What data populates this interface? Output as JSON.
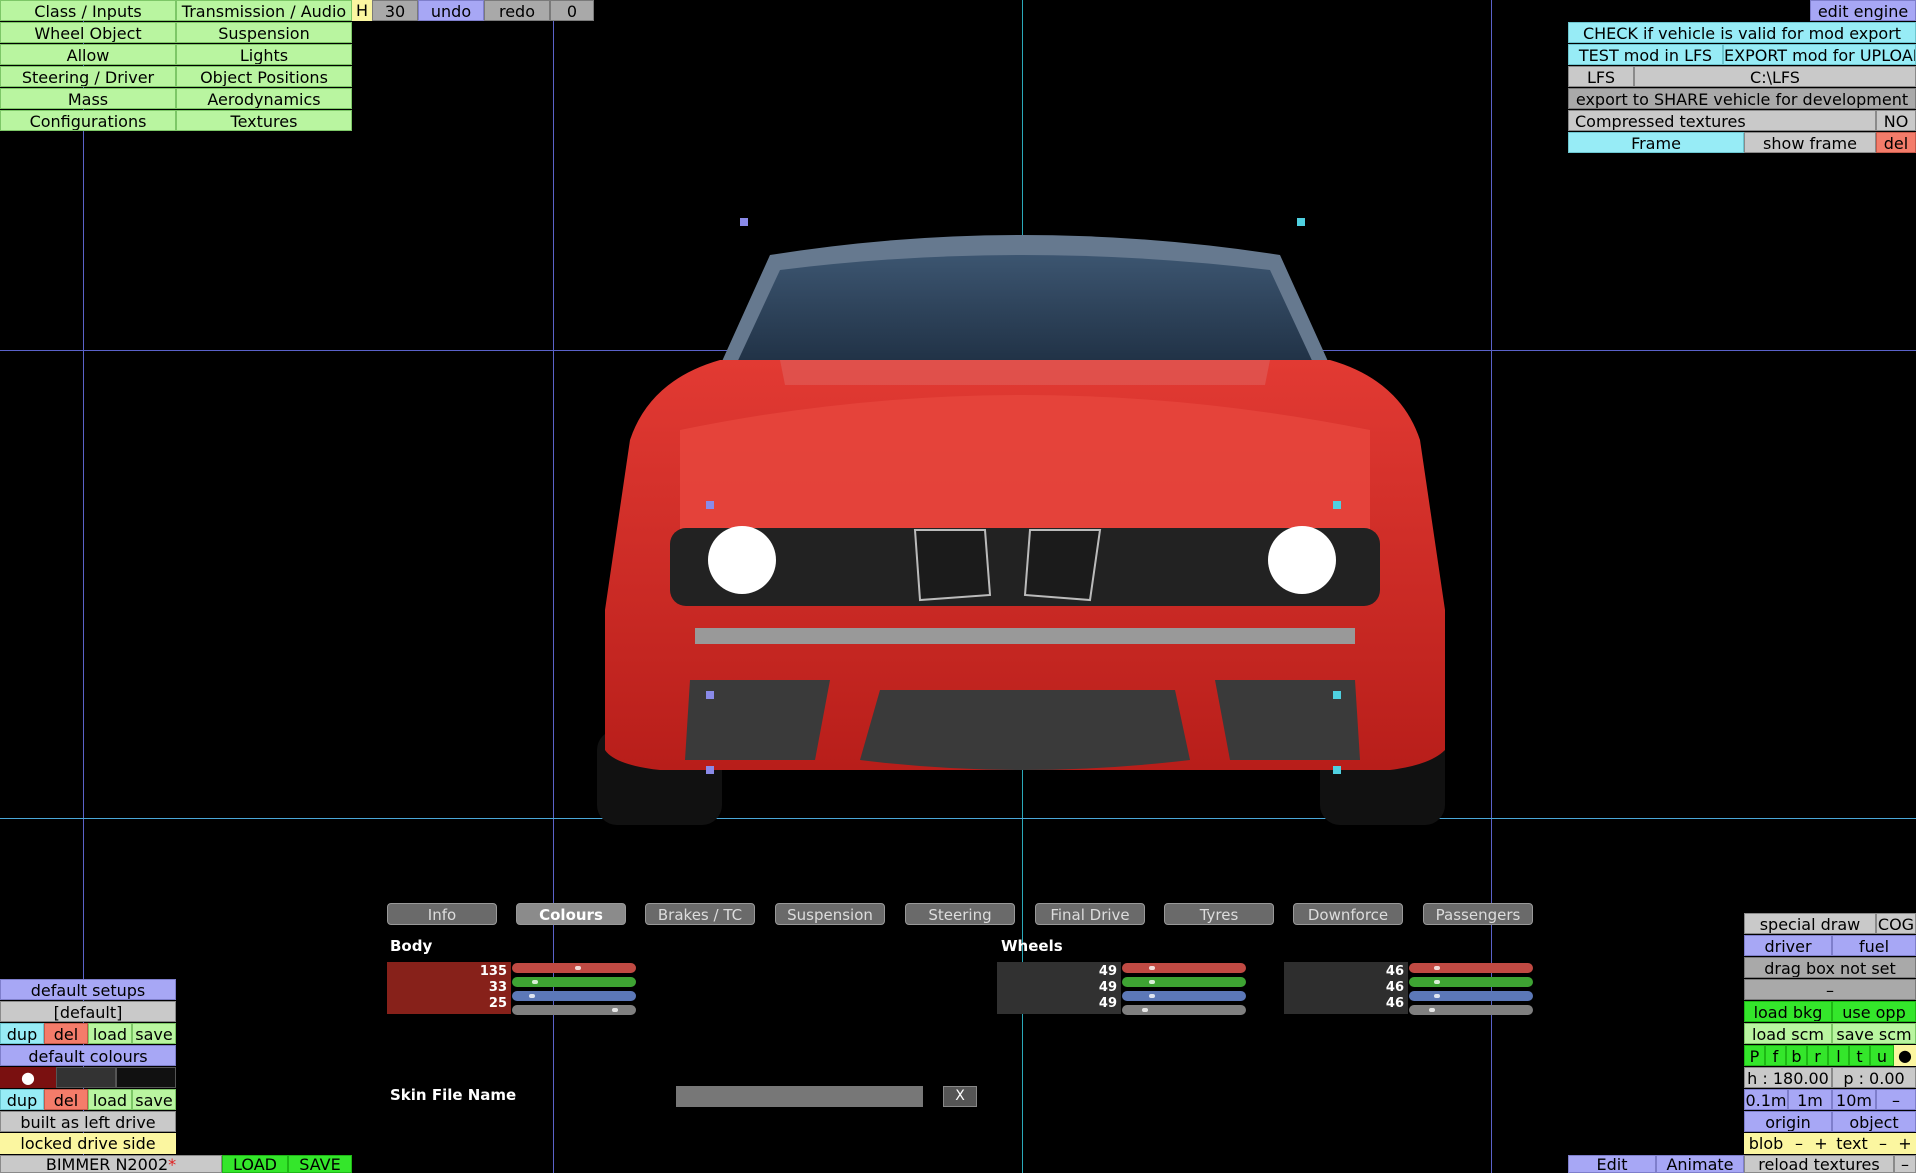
{
  "top_menu": {
    "col1": [
      "Class / Inputs",
      "Wheel Object",
      "Allow",
      "Steering / Driver",
      "Mass",
      "Configurations"
    ],
    "col2": [
      "Transmission / Audio",
      "Suspension",
      "Lights",
      "Object Positions",
      "Aerodynamics",
      "Textures"
    ],
    "h_label": "H",
    "count": "30",
    "undo": "undo",
    "redo": "redo",
    "redo_count": "0"
  },
  "right_panel": {
    "edit_engine": "edit engine",
    "check_valid": "CHECK if vehicle is valid for mod export",
    "test_mod": "TEST mod in LFS",
    "export_mod": "EXPORT mod for UPLOAD",
    "lfs": "LFS",
    "lfs_path": "C:\\LFS",
    "export_share": "export to SHARE vehicle for development",
    "compressed": "Compressed textures",
    "compressed_value": "NO",
    "frame": "Frame",
    "show_frame": "show frame",
    "del": "del"
  },
  "tabs": [
    "Info",
    "Colours",
    "Brakes / TC",
    "Suspension",
    "Steering",
    "Final Drive",
    "Tyres",
    "Downforce",
    "Passengers"
  ],
  "active_tab": "Colours",
  "colours": {
    "body_label": "Body",
    "wheels_label": "Wheels",
    "body": {
      "r": "135",
      "g": "33",
      "b": "25",
      "r_frac": 0.53,
      "g_frac": 0.13,
      "b_frac": 0.1,
      "color": "#87211a"
    },
    "wheels1": {
      "r": "49",
      "g": "49",
      "b": "49",
      "r_frac": 0.19,
      "g_frac": 0.19,
      "b_frac": 0.19,
      "color": "#313131"
    },
    "wheels2": {
      "r": "46",
      "g": "46",
      "b": "46",
      "r_frac": 0.18,
      "g_frac": 0.18,
      "b_frac": 0.18,
      "color": "#2e2e2e"
    },
    "skin_label": "Skin File Name",
    "skin_value": "",
    "skin_clear": "X"
  },
  "left_panel": {
    "default_setups": "default setups",
    "default_value": "[default]",
    "dup": "dup",
    "del": "del",
    "load": "load",
    "save": "save",
    "default_colours": "default colours",
    "swatch_dot": "●",
    "built_left": "built as left drive",
    "locked_side": "locked drive side"
  },
  "status_bar": {
    "name": "BIMMER N2002",
    "modified_mark": "*",
    "load": "LOAD",
    "save": "SAVE"
  },
  "bottom_right": {
    "special_draw": "special draw",
    "cog": "COG",
    "driver": "driver",
    "fuel": "fuel",
    "drag_box": "drag box not set",
    "dash": "–",
    "load_bkg": "load bkg",
    "use_opp": "use opp",
    "load_scm": "load scm",
    "save_scm": "save scm",
    "letters": [
      "P",
      "f",
      "b",
      "r",
      "l",
      "t",
      "u",
      "●"
    ],
    "heading": "h : 180.00",
    "pitch": "p : 0.00",
    "step1": "0.1m",
    "step2": "1m",
    "step3": "10m",
    "minus": "–",
    "origin": "origin",
    "object": "object",
    "blob": "blob",
    "plus": "+",
    "text": "text",
    "edit": "Edit",
    "animate": "Animate",
    "reload_textures": "reload textures"
  }
}
